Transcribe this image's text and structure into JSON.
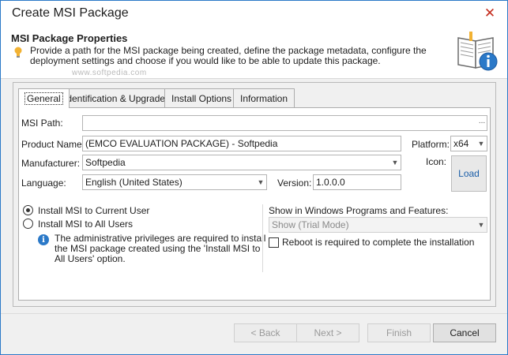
{
  "window": {
    "title": "Create MSI Package",
    "close_glyph": "✕"
  },
  "header": {
    "title": "MSI Package Properties",
    "description": "Provide a path for the MSI package being created, define the package metadata, configure the deployment settings and choose if you would like to be able to update this package.",
    "watermark": "www.softpedia.com",
    "icons": [
      "lightbulb-icon",
      "book-info-icon"
    ]
  },
  "tabs": [
    {
      "label": "General",
      "active": true
    },
    {
      "label": "Identification & Upgrade",
      "active": false
    },
    {
      "label": "Install Options",
      "active": false
    },
    {
      "label": "Information",
      "active": false
    }
  ],
  "general": {
    "msi_path": {
      "label": "MSI Path:",
      "value": "",
      "browse_glyph": "..."
    },
    "product_name": {
      "label": "Product Name:",
      "value": "(EMCO EVALUATION PACKAGE) - Softpedia"
    },
    "manufacturer": {
      "label": "Manufacturer:",
      "value": "Softpedia"
    },
    "language": {
      "label": "Language:",
      "value": "English (United States)"
    },
    "version": {
      "label": "Version:",
      "value": "1.0.0.0"
    },
    "platform": {
      "label": "Platform:",
      "value": "x64"
    },
    "icon": {
      "label": "Icon:",
      "load_label": "Load"
    },
    "install_scope": {
      "options": [
        {
          "label": "Install MSI to Current User",
          "selected": true
        },
        {
          "label": "Install MSI to All Users",
          "selected": false
        }
      ],
      "note": "The administrative privileges are required to install the MSI package created using the 'Install MSI to All Users' option."
    },
    "show_in_programs": {
      "label": "Show in Windows Programs and Features:",
      "value": "Show (Trial Mode)"
    },
    "reboot": {
      "label": "Reboot is required to complete the installation",
      "checked": false
    }
  },
  "footer": {
    "back": "< Back",
    "next": "Next >",
    "finish": "Finish",
    "cancel": "Cancel"
  },
  "colors": {
    "accent": "#2b79c8",
    "close": "#c42b1c",
    "link": "#1a5ea8"
  }
}
